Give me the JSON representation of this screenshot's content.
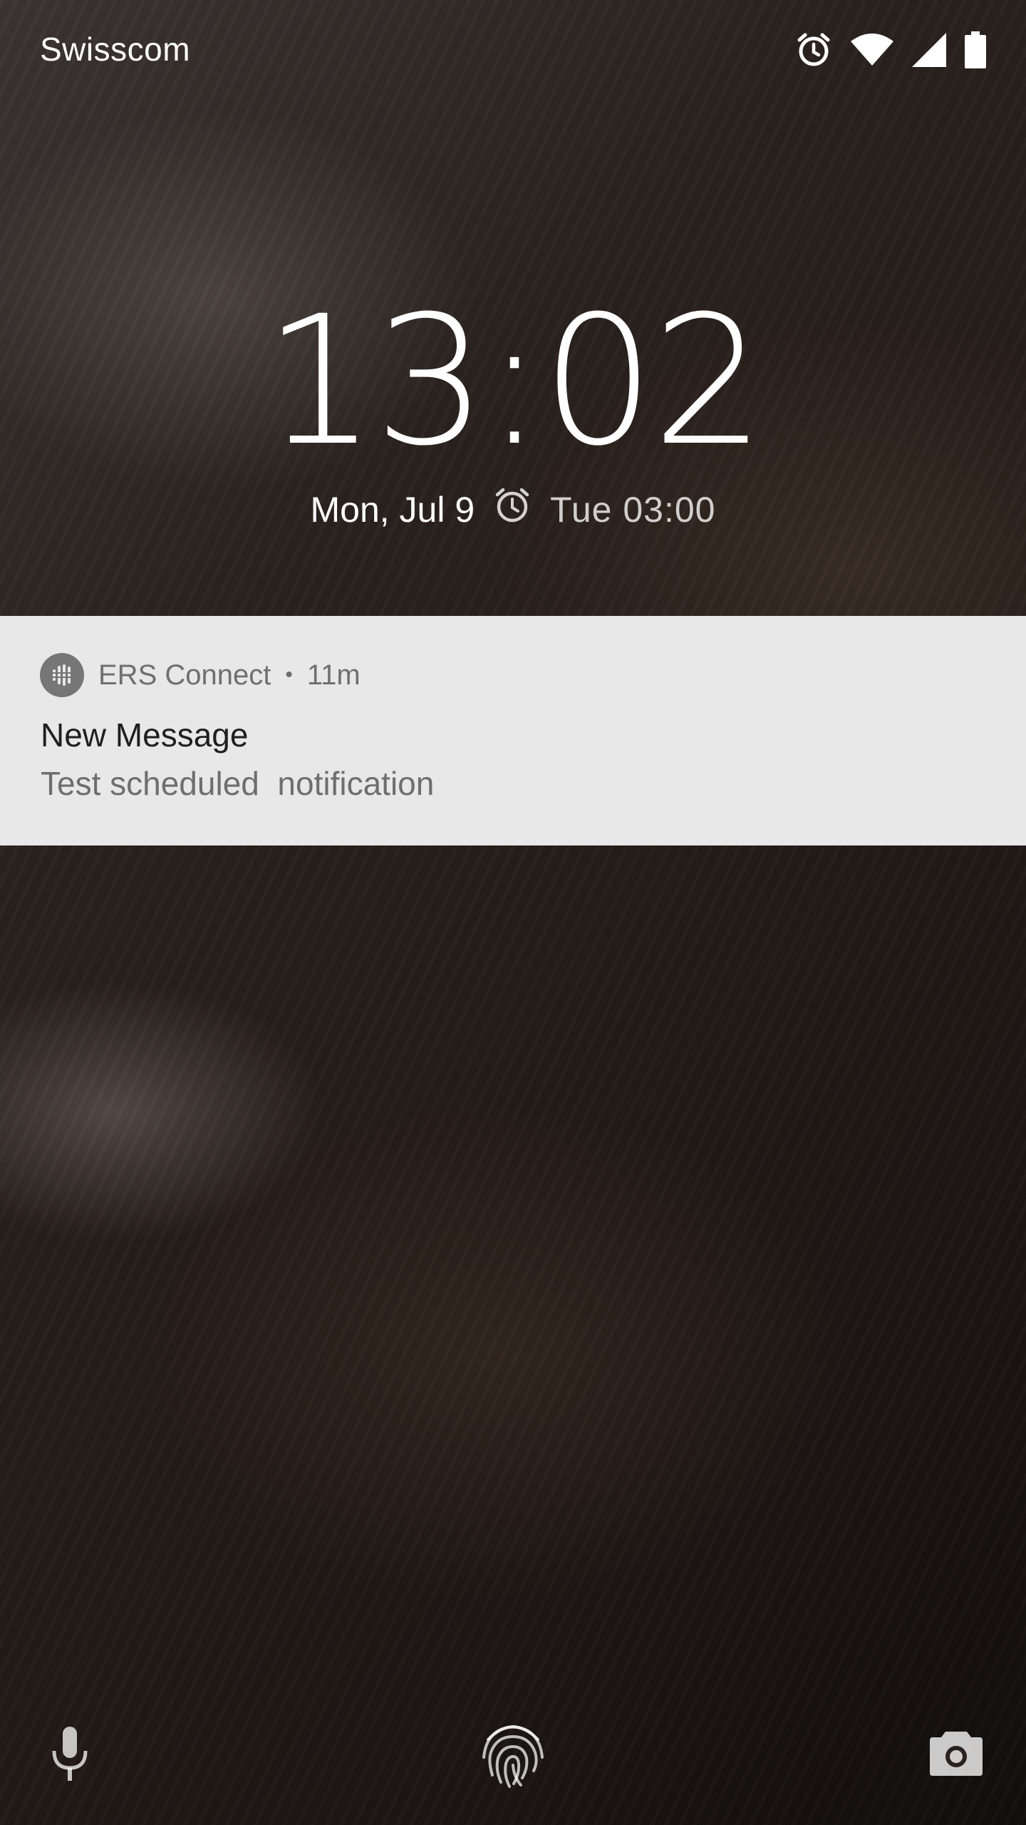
{
  "status_bar": {
    "carrier": "Swisscom",
    "icons": [
      "alarm-icon",
      "wifi-icon",
      "signal-icon",
      "battery-icon"
    ]
  },
  "lock_screen": {
    "time": "13:02",
    "date": "Mon, Jul 9",
    "next_alarm": "Tue 03:00"
  },
  "notification": {
    "app_name": "ERS Connect",
    "separator": "•",
    "age": "11m",
    "title": "New Message",
    "text": "Test scheduled  notification",
    "background_color": "#e8e8e8"
  },
  "bottom_shortcuts": [
    "microphone-icon",
    "fingerprint-icon",
    "camera-icon"
  ]
}
